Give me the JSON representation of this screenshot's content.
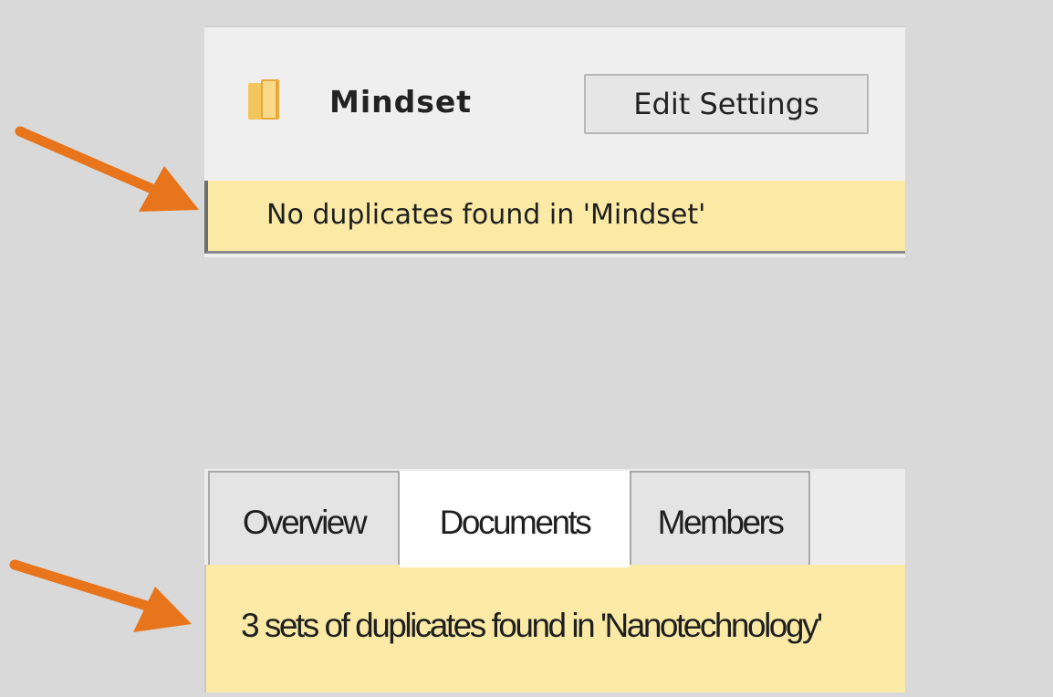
{
  "top_panel": {
    "group_name": "Mindset",
    "edit_settings_label": "Edit Settings",
    "notice_text": "No duplicates found in 'Mindset'"
  },
  "bottom_panel": {
    "tabs": [
      {
        "label": "Overview",
        "active": false
      },
      {
        "label": "Documents",
        "active": true
      },
      {
        "label": "Members",
        "active": false
      }
    ],
    "notice_text": "3 sets of duplicates found in 'Nanotechnology'"
  },
  "icons": {
    "folder": "folder-icon",
    "annotation_arrow": "arrow-icon"
  },
  "colors": {
    "background": "#d9d9d9",
    "notice_yellow": "#fbe9a6",
    "arrow_orange": "#e8741c",
    "folder_yellow": "#f2c14e"
  }
}
